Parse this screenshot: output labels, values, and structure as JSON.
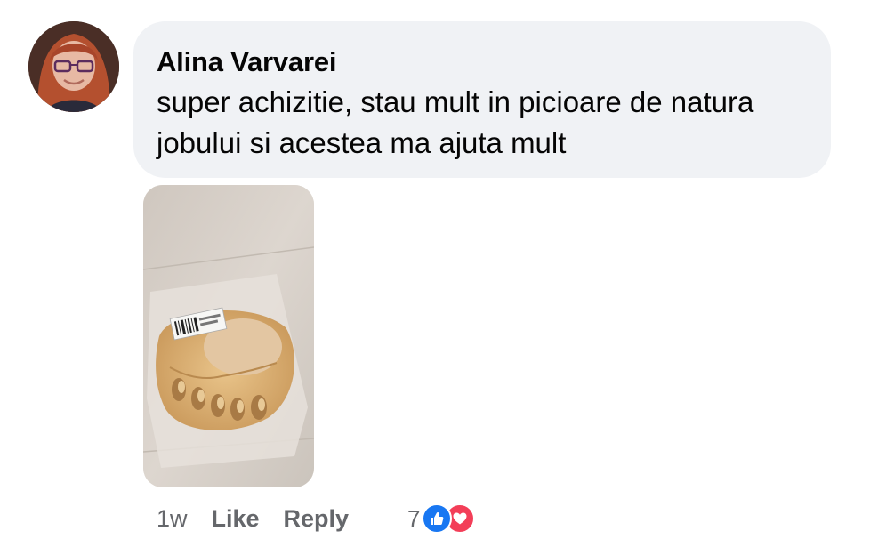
{
  "comment": {
    "author": "Alina Varvarei",
    "text": "super achizitie, stau mult in picioare de natura jobului si acestea ma ajuta mult",
    "timestamp": "1w",
    "actions": {
      "like_label": "Like",
      "reply_label": "Reply"
    },
    "reactions": {
      "count": "7",
      "types": [
        "like-icon",
        "love-icon"
      ]
    },
    "attachment": {
      "type": "photo",
      "subject": "beige toe cushion pads in plastic bag"
    }
  },
  "colors": {
    "bubble_bg": "#f0f2f5",
    "text": "#050505",
    "secondary_text": "#65676b",
    "like_blue": "#1877f2",
    "love_red": "#f33e58"
  }
}
